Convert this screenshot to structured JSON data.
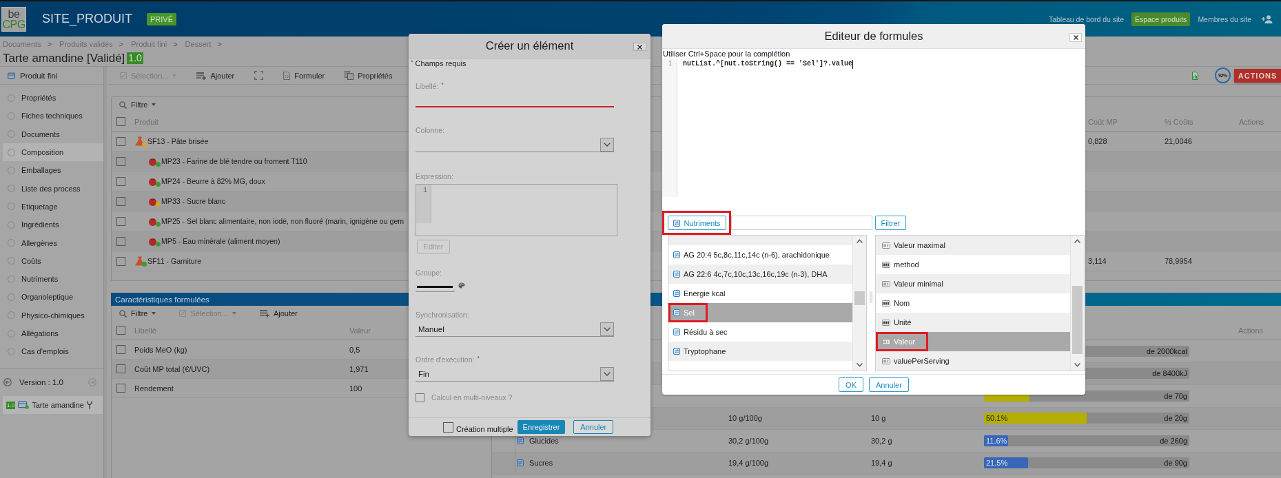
{
  "header": {
    "logo": {
      "line_1": "be",
      "line_2": "CPG"
    },
    "site": "SITE_PRODUIT",
    "badge": "PRIVÉ",
    "links": [
      {
        "label": "Tableau de bord du site",
        "selected": false
      },
      {
        "label": "Espace produits",
        "selected": true
      },
      {
        "label": "Membres du site",
        "selected": false
      }
    ]
  },
  "breadcrumb": [
    {
      "label": "Documents",
      "separator": ">"
    },
    {
      "label": "Produits validés",
      "separator": ">"
    },
    {
      "label": "Produit fini",
      "separator": ">"
    },
    {
      "label": "Dessert",
      "separator": ">"
    }
  ],
  "title": {
    "text": "Tarte amandine [Validé]",
    "version": "1.0"
  },
  "sidebar": {
    "heading": "Produit fini",
    "items": [
      {
        "label": "Propriétés",
        "selected": false
      },
      {
        "label": "Fiches techniques",
        "selected": false
      },
      {
        "label": "Documents",
        "selected": false
      },
      {
        "label": "Composition",
        "selected": true
      },
      {
        "label": "Emballages",
        "selected": false
      },
      {
        "label": "Liste des process",
        "selected": false
      },
      {
        "label": "Etiquetage",
        "selected": false
      },
      {
        "label": "Ingrédients",
        "selected": false
      },
      {
        "label": "Allergènes",
        "selected": false
      },
      {
        "label": "Coûts",
        "selected": false
      },
      {
        "label": "Nutriments",
        "selected": false
      },
      {
        "label": "Organoleptique",
        "selected": false
      },
      {
        "label": "Physico-chimiques",
        "selected": false
      },
      {
        "label": "Allégations",
        "selected": false
      },
      {
        "label": "Cas d'emplois",
        "selected": false
      }
    ],
    "version_nav": {
      "label": "Version : 1.0",
      "previous_disabled": false,
      "next_disabled": true
    },
    "versions": [
      {
        "badge": "1.0",
        "name": "Tarte amandine",
        "selected": true
      }
    ]
  },
  "toolbar": {
    "items": [
      {
        "kind": "selection",
        "label": "Sélection...",
        "disabled": true
      },
      {
        "kind": "add",
        "label": "Ajouter",
        "disabled": false
      },
      {
        "kind": "expand",
        "disabled": false
      },
      {
        "kind": "formulate",
        "label": "Formuler",
        "disabled": false
      },
      {
        "kind": "properties",
        "label": "Propriétés",
        "disabled": false
      }
    ],
    "progress": "92%",
    "actions": "ACTIONS"
  },
  "composition": {
    "filter": "Filtre",
    "select_all_checked": false,
    "columns": [
      "Produit",
      "Coût MP",
      "% Coûts",
      "Actions"
    ],
    "rows": [
      {
        "kind": "semi-finished",
        "name": "SF13 - Pâte brisée",
        "color": "#d2a91f",
        "checked": false,
        "cost": "0,828",
        "share": "21,0046",
        "children": [
          {
            "kind": "raw-material",
            "name": "MP23 - Farine de blé tendre ou froment T110",
            "color": "#3c9c2d",
            "checked": false
          },
          {
            "kind": "raw-material",
            "name": "MP24 - Beurre à 82% MG, doux",
            "color": "#3c9c2d",
            "checked": false
          },
          {
            "kind": "raw-material",
            "name": "MP33 - Sucre blanc",
            "color": "#d2a91f",
            "checked": false
          },
          {
            "kind": "raw-material",
            "name": "MP25 - Sel blanc alimentaire, non iodé, non fluoré (marin, ignigène ou gem",
            "color": "#3c9c2d",
            "checked": false
          },
          {
            "kind": "raw-material",
            "name": "MP5 - Eau minérale (aliment moyen)",
            "color": "#3c9c2d",
            "checked": false
          }
        ]
      },
      {
        "kind": "semi-finished",
        "name": "SF11 - Garniture",
        "color": "#3c9c2d",
        "checked": false,
        "cost": "3,114",
        "share": "78,9954"
      }
    ]
  },
  "characteristics": {
    "title": "Caractéristiques formulées",
    "toolbar": [
      {
        "kind": "filter",
        "label": "Filtre",
        "disabled": false
      },
      {
        "kind": "selection",
        "label": "Sélection...",
        "disabled": true
      },
      {
        "kind": "add",
        "label": "Ajouter",
        "disabled": false
      }
    ],
    "select_all_checked": false,
    "columns": [
      "Libellé",
      "Valeur"
    ],
    "rows": [
      {
        "label": "Poids MeO (kg)",
        "value": "0,5",
        "checked": false
      },
      {
        "label": "Coût MP total (€/UVC)",
        "value": "1,971",
        "checked": false
      },
      {
        "label": "Rendement",
        "value": "100",
        "checked": false
      }
    ]
  },
  "nutrients": {
    "columns": [
      "Actions"
    ],
    "rows": [
      {
        "goal": "de 2000kcal"
      },
      {
        "goal": "de 8400kJ"
      },
      {
        "goal": "de 70g",
        "level": 0.22,
        "color": "#b3ae00"
      },
      {
        "per_100g": "10 g/100g",
        "quantity": "10 g",
        "level": 0.501,
        "color": "#b3ae00",
        "percent": "50.1%",
        "goal": "de 20g"
      },
      {
        "name": "Glucides",
        "per_100g": "30,2 g/100g",
        "quantity": "30,2 g",
        "level": 0.116,
        "color": "#3a66b8",
        "percent": "11.6%",
        "goal": "de 260g"
      },
      {
        "name": "Sucres",
        "per_100g": "19,4 g/100g",
        "quantity": "19,4 g",
        "level": 0.215,
        "color": "#3a66b8",
        "percent": "21.5%",
        "goal": "de 90g"
      }
    ]
  },
  "create_dialog": {
    "title": "Créer un élément",
    "required_note": {
      "mark": "*",
      "text": "Champs requis"
    },
    "fields": [
      {
        "kind": "text",
        "label": "Libellé:",
        "mark": "*",
        "invalid": true
      },
      {
        "kind": "select",
        "label": "Colonne:"
      },
      {
        "kind": "code",
        "label": "Expression:",
        "line_numbers": [
          "1"
        ],
        "button": {
          "label": "Editer",
          "disabled": true
        }
      },
      {
        "kind": "color",
        "label": "Groupe:"
      },
      {
        "kind": "select",
        "label": "Synchronisation:",
        "value": "Manuel"
      },
      {
        "kind": "select",
        "label": "Ordre d'exécution:",
        "mark": "*",
        "value": "Fin"
      },
      {
        "kind": "checkbox",
        "label": "Calcul en multi-niveaux ?",
        "checked": false
      }
    ],
    "multiple": {
      "label": "Création multiple",
      "checked": false
    },
    "buttons": [
      {
        "kind": "primary",
        "label": "Enregistrer"
      },
      {
        "kind": "secondary",
        "label": "Annuler"
      }
    ]
  },
  "formula_editor": {
    "title": "Editeur de formules",
    "hint": "Utiliser Ctrl+Space pour la complétion",
    "code": [
      {
        "number": "1",
        "text": "nutList.^[nut.toString() == 'Sel']?.value",
        "cursor": true
      }
    ],
    "source_button": {
      "label": "Nutriments",
      "highlighted": true
    },
    "filter_button": "Filtrer",
    "entities": [
      {
        "label": "AG 20:4 5c,8c,11c,14c (n-6), arachidonique",
        "selected": false,
        "highlighted": false
      },
      {
        "label": "AG 22:6 4c,7c,10c,13c,16c,19c (n-3), DHA",
        "selected": false,
        "highlighted": false
      },
      {
        "label": "Energie kcal",
        "selected": false,
        "highlighted": false
      },
      {
        "label": "Sel",
        "selected": true,
        "highlighted": true
      },
      {
        "label": "Résidu à sec",
        "selected": false,
        "highlighted": false
      },
      {
        "label": "Tryptophane",
        "selected": false,
        "highlighted": false
      }
    ],
    "properties": [
      {
        "kind": "number",
        "label": "Valeur maximal",
        "selected": false,
        "highlighted": false
      },
      {
        "kind": "text",
        "label": "method",
        "selected": false,
        "highlighted": false
      },
      {
        "kind": "number",
        "label": "Valeur minimal",
        "selected": false,
        "highlighted": false
      },
      {
        "kind": "text",
        "label": "Nom",
        "selected": false,
        "highlighted": false
      },
      {
        "kind": "text",
        "label": "Unité",
        "selected": false,
        "highlighted": false
      },
      {
        "kind": "number",
        "label": "Valeur",
        "selected": true,
        "highlighted": true
      },
      {
        "kind": "number",
        "label": "valuePerServing",
        "selected": false,
        "highlighted": false
      }
    ],
    "buttons": [
      "OK",
      "Annuler"
    ]
  }
}
